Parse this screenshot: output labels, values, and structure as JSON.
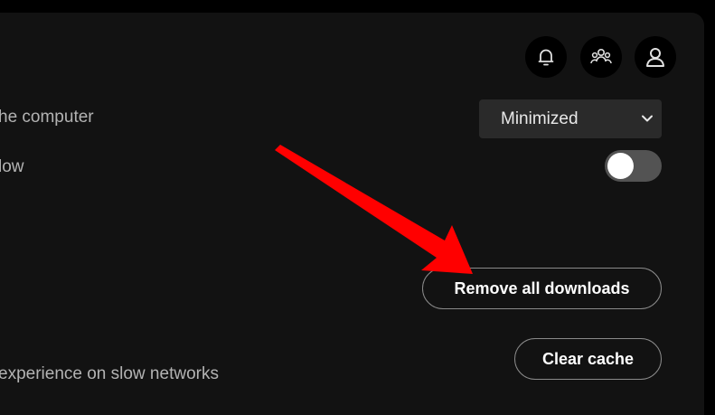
{
  "header": {
    "icons": [
      "bell-icon",
      "friend-activity-icon",
      "user-icon"
    ]
  },
  "settings": {
    "close_button_label": "he computer",
    "close_button_value": "Minimized",
    "animation_label": "low",
    "animation_toggle_on": false,
    "remove_downloads_label": "Remove all downloads",
    "cache_label": "experience on slow networks",
    "clear_cache_label": "Clear cache"
  },
  "colors": {
    "panel_bg": "#121212",
    "annotation_arrow": "#ff0000",
    "toggle_track": "#535353"
  }
}
